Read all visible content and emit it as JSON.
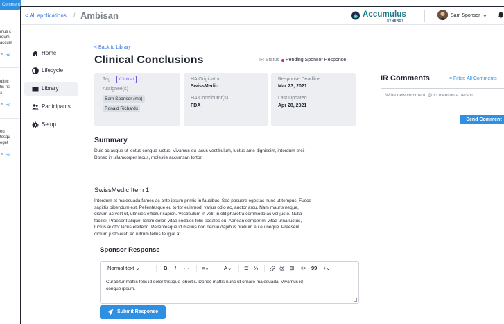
{
  "background_window": {
    "button_label": "Comment",
    "snippets": [
      [
        "mus c",
        "rdum",
        "accum"
      ],
      [
        "ultric",
        "tis ris",
        "s"
      ],
      [
        "eu",
        "tesqu",
        "eget"
      ]
    ],
    "reply_label": "Re"
  },
  "header": {
    "back_label": "< All applications",
    "separator": "/",
    "app_title": "Ambisan",
    "brand_name": "Accumulus",
    "brand_sub": "SYNERGY",
    "user_name": "Sam Sponsor",
    "user_chevron": "⌄"
  },
  "sidebar": {
    "items": [
      {
        "label": "Home",
        "icon": "home-icon",
        "active": false
      },
      {
        "label": "Lifecycle",
        "icon": "lifecycle-icon",
        "active": false
      },
      {
        "label": "Library",
        "icon": "folder-icon",
        "active": true
      },
      {
        "label": "Participants",
        "icon": "users-icon",
        "active": false
      },
      {
        "label": "Setup",
        "icon": "gear-icon",
        "active": false
      }
    ]
  },
  "main": {
    "back_link": "< Back to Library",
    "title": "Clinical Conclusions",
    "ir_status_label": "IR Status",
    "ir_status_value": "Pending Sponsor Response",
    "ir_status_color": "#c0268f",
    "info": {
      "tag_label": "Tag",
      "tag_value": "Clinical",
      "assignee_label": "Assignee(s)",
      "assignees": [
        "Sam Sponsor (me)",
        "Ronald Richards"
      ],
      "ha_originator_label": "HA Originator",
      "ha_originator": "SwissMedic",
      "ha_contributor_label": "HA Contributor(s)",
      "ha_contributor": "FDA",
      "deadline_label": "Response Deadline",
      "deadline": "Mar 23, 2021",
      "updated_label": "Last Updated",
      "updated": "Apr 28, 2021"
    },
    "summary_heading": "Summary",
    "summary_lines": [
      "Duis ac augue ut lectus congue luctus. Vivamus eu lacus vestibulum, luctus ante dignissim, interdum orci.",
      "Donec in ullamcorper lacus, molestie accumsan tortor."
    ],
    "item_heading": "SwissMedic Item 1",
    "item_lines": [
      "Interdum et malesuada fames ac ante ipsum primis in faucibus. Sed posuere egestas nunc ut tempus. Fusce",
      "sagittis bibendum est. Pellentesque eu tortor euismod, varius odio ac, auctor arcu. Nam mauris neque,",
      "dictum ac velit ut, ultricies efficitur sapien. Vestibulum in velit in elit pharetra commodo ac vel justo. Nulla",
      "facilisi. Praesent aliquet lorem dolor, vitae sodales felis sodales eu. Aenean semper mi vitae urna luctus,",
      "luctus auctor lacus eleifend. Pellentesque id mauris non neque dapibus pretium eu eu neque. Praesent",
      "dictum justo erat, ac rutrum tellus feugiat at."
    ],
    "sponsor_heading": "Sponsor Response",
    "editor": {
      "style_select": "Normal text",
      "chevron": "⌄",
      "bold": "B",
      "italic": "I",
      "more": "···",
      "align": "≡",
      "color": "A",
      "bullet": "☰",
      "numbered": "⅓",
      "link": "🔗",
      "mention": "@",
      "table": "⊞",
      "code": "<>",
      "quote": "99",
      "plus": "+",
      "text_lines": [
        "Curabitur mattis felis id dolor tristique lobortis. Donec mattis nunc ut ornare malesuada. Vivamus id",
        "congue ipsum."
      ]
    },
    "submit_label": "Submit Response"
  },
  "comments_panel": {
    "heading": "IR Comments",
    "filter_label": "Filter: All Comments",
    "input_placeholder": "Write new comment, @ to mention a person",
    "send_label": "Send Comment"
  }
}
